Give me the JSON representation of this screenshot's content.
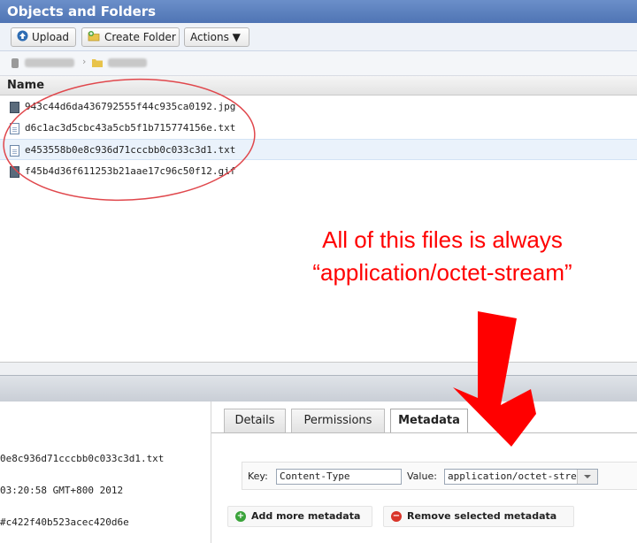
{
  "panel": {
    "title": "Objects and Folders"
  },
  "toolbar": {
    "upload": "Upload",
    "create_folder": "Create Folder",
    "actions": "Actions ▼"
  },
  "list": {
    "column_name": "Name",
    "files": [
      {
        "name": "943c44d6da436792555f44c935ca0192.jpg",
        "icon": "image-file-icon"
      },
      {
        "name": "d6c1ac3d5cbc43a5cb5f1b715774156e.txt",
        "icon": "text-file-icon"
      },
      {
        "name": "e453558b0e8c936d71cccbb0c033c3d1.txt",
        "icon": "text-file-icon"
      },
      {
        "name": "f45b4d36f611253b21aae17c96c50f12.gif",
        "icon": "image-file-icon"
      }
    ]
  },
  "details": {
    "values": [
      "0e8c936d71cccbb0c033c3d1.txt",
      "03:20:58 GMT+800 2012",
      "#c422f40b523acec420d6e"
    ]
  },
  "tabs": [
    "Details",
    "Permissions",
    "Metadata"
  ],
  "metadata": {
    "key_label": "Key:",
    "key_value": "Content-Type",
    "value_label": "Value:",
    "value_value": "application/octet-stream",
    "add_label": "Add more metadata",
    "remove_label": "Remove selected metadata"
  },
  "annotation": {
    "line1": "All of this files is always",
    "line2": "“application/octet-stream”",
    "color": "#ff0000"
  }
}
